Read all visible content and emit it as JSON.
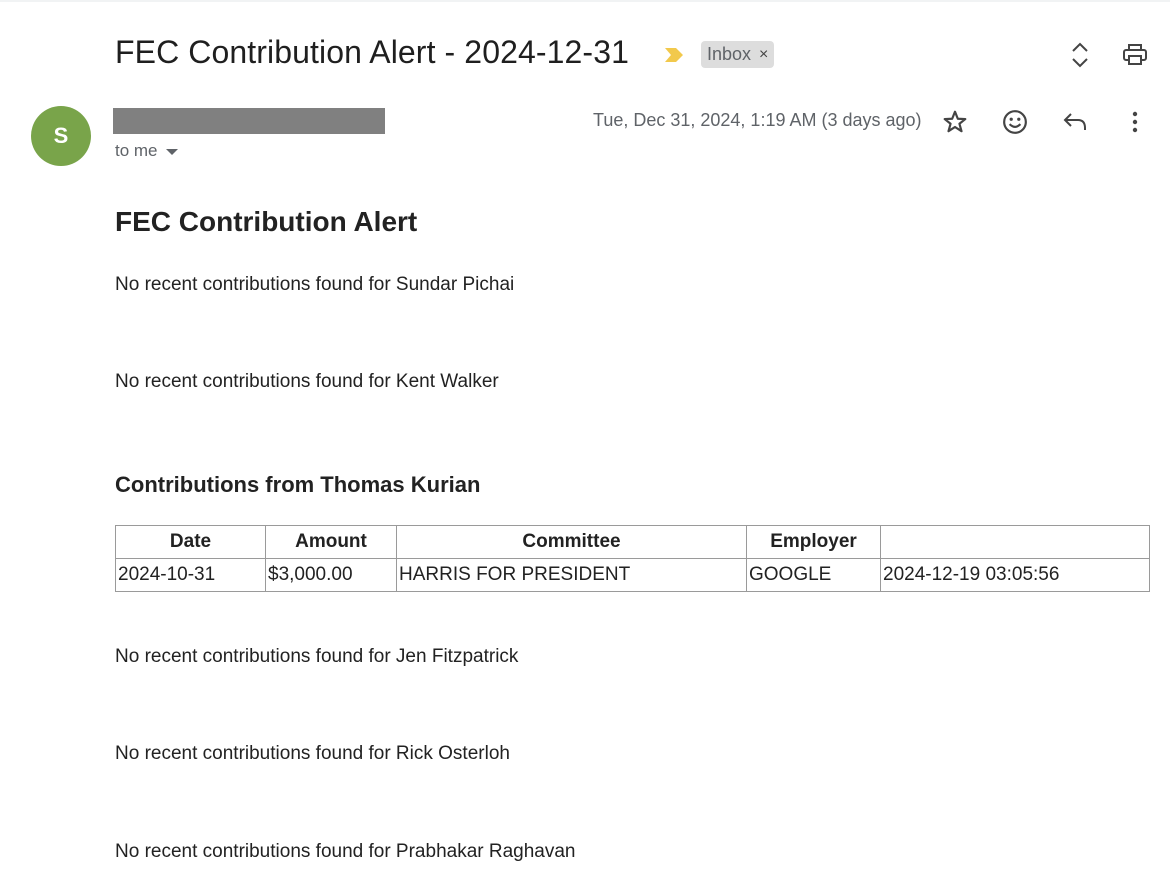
{
  "email": {
    "subject": "FEC Contribution Alert - 2024-12-31",
    "label": "Inbox",
    "label_remove": "×",
    "sender_initial": "S",
    "recipient": "to me",
    "date": "Tue, Dec 31, 2024, 1:19 AM (3 days ago)"
  },
  "icons": {
    "importance": "importance-marker-icon",
    "expand": "expand-collapse-icon",
    "print": "print-icon",
    "star": "star-icon",
    "emoji": "emoji-reaction-icon",
    "reply": "reply-icon",
    "more": "more-vert-icon"
  },
  "colors": {
    "avatar": "#79a44a",
    "importance": "#f2c94c",
    "chip": "#dddddd",
    "redaction": "#808080"
  },
  "body": {
    "heading": "FEC Contribution Alert",
    "line1": "No recent contributions found for Sundar Pichai",
    "line2": "No recent contributions found for Kent Walker",
    "section_heading": "Contributions from Thomas Kurian",
    "table": {
      "headers": [
        "Date",
        "Amount",
        "Committee",
        "Employer",
        ""
      ],
      "rows": [
        [
          "2024-10-31",
          "$3,000.00",
          "HARRIS FOR PRESIDENT",
          "GOOGLE",
          "2024-12-19 03:05:56"
        ]
      ]
    },
    "line3": "No recent contributions found for Jen Fitzpatrick",
    "line4": "No recent contributions found for Rick Osterloh",
    "line5": "No recent contributions found for Prabhakar Raghavan"
  }
}
